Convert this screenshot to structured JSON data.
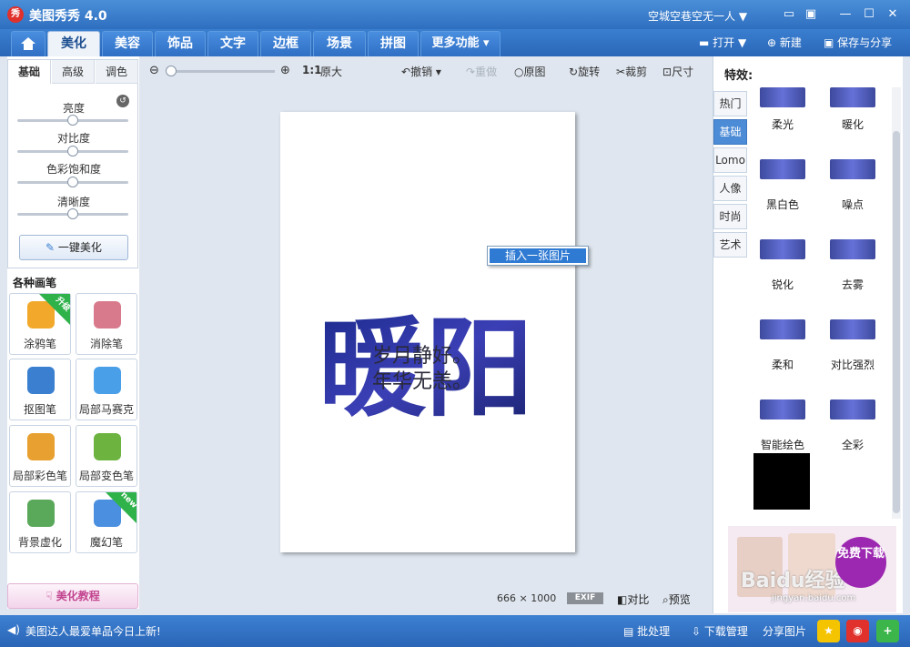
{
  "app": {
    "logo": "秀",
    "title": "美图秀秀 4.0",
    "user": "空城空巷空无一人 ▼"
  },
  "window_buttons": {
    "min": "—",
    "max": "☐",
    "close": "✕",
    "chat": "▭",
    "skin": "▣"
  },
  "tabs": [
    {
      "label": ""
    },
    {
      "label": "美化"
    },
    {
      "label": "美容"
    },
    {
      "label": "饰品"
    },
    {
      "label": "文字"
    },
    {
      "label": "边框"
    },
    {
      "label": "场景"
    },
    {
      "label": "拼图"
    },
    {
      "label": "更多功能 ▾"
    }
  ],
  "top_actions": {
    "open": "打开 ▼",
    "new": "新建",
    "save": "保存与分享"
  },
  "adjust": {
    "subtabs": [
      "基础",
      "高级",
      "调色"
    ],
    "sliders": [
      {
        "label": "亮度",
        "level": 0.5
      },
      {
        "label": "对比度",
        "level": 0.5
      },
      {
        "label": "色彩饱和度",
        "level": 0.5
      },
      {
        "label": "清晰度",
        "level": 0.5
      }
    ],
    "one_key": "一键美化"
  },
  "brushes": {
    "title": "各种画笔",
    "items": [
      {
        "label": "涂鸦笔",
        "badge": "升级",
        "icon": "brush-icon",
        "color": "#f2a92b"
      },
      {
        "label": "消除笔",
        "badge": "",
        "icon": "eraser-icon",
        "color": "#d87a8c"
      },
      {
        "label": "抠图笔",
        "badge": "",
        "icon": "pen-icon",
        "color": "#3a7fd0"
      },
      {
        "label": "局部马赛克",
        "badge": "",
        "icon": "mosaic-icon",
        "color": "#4aa0e8"
      },
      {
        "label": "局部彩色笔",
        "badge": "",
        "icon": "color-brush-icon",
        "color": "#e8a030"
      },
      {
        "label": "局部变色笔",
        "badge": "",
        "icon": "paint-bucket-icon",
        "color": "#6cb33f"
      },
      {
        "label": "背景虚化",
        "badge": "",
        "icon": "blur-icon",
        "color": "#5aa85a"
      },
      {
        "label": "魔幻笔",
        "badge": "new",
        "icon": "magic-pen-icon",
        "color": "#4a8fe0"
      }
    ]
  },
  "tutorial": "美化教程",
  "toolbar": {
    "zoom_reset": "1:1",
    "original_size": "原大",
    "undo": "撤销 ▾",
    "redo": "重做",
    "original": "原图",
    "rotate": "旋转",
    "crop": "裁剪",
    "resize": "尺寸"
  },
  "canvas": {
    "art_big_text": "暖阳",
    "line1": "岁月静好。",
    "line2": "年华无恙。",
    "context_menu": "插入一张图片",
    "size_w": "666",
    "size_x": "×",
    "size_h": "1000",
    "exif": "EXIF",
    "compare": "对比",
    "preview": "预览"
  },
  "effects": {
    "title": "特效:",
    "tabs": [
      "热门",
      "基础",
      "Lomo",
      "人像",
      "时尚",
      "艺术"
    ],
    "active_tab": 1,
    "items": [
      "柔光",
      "暖化",
      "黑白色",
      "噪点",
      "锐化",
      "去雾",
      "柔和",
      "对比强烈",
      "智能绘色",
      "全彩"
    ]
  },
  "ad": {
    "cta": "免费下载",
    "watermark": "Baidu经验",
    "site": "jingyan.baidu.com"
  },
  "statusbar": {
    "message": "美图达人最爱单品今日上新!",
    "batch": "批处理",
    "download": "下载管理",
    "share": "分享图片"
  },
  "colors": {
    "accent": "#2f6fc0",
    "selection": "#2f7ad3",
    "art_blue": "#1a2a8a"
  }
}
